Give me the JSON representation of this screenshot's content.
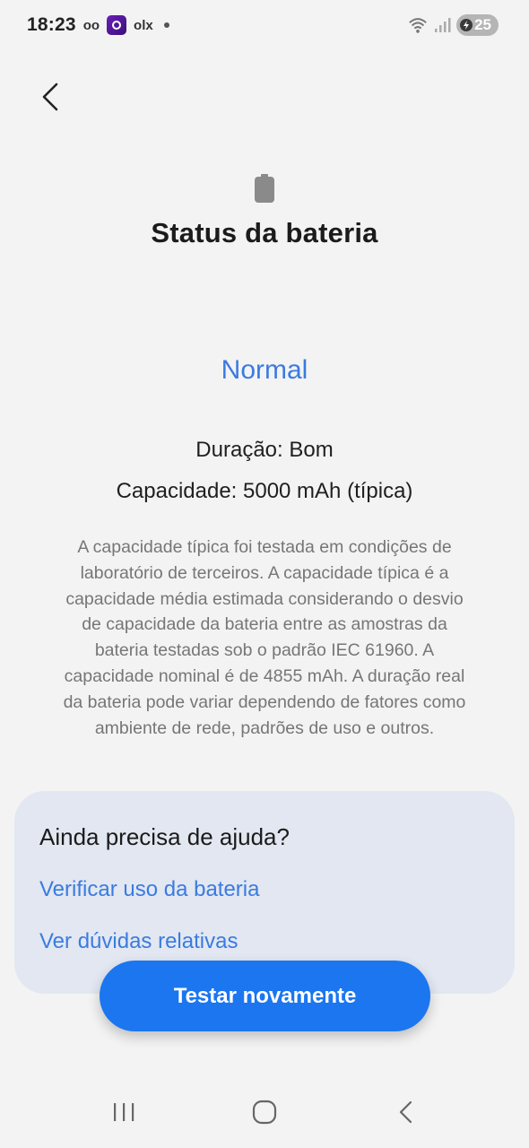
{
  "status_bar": {
    "time": "18:23",
    "voicemail_glyph": "oo",
    "app_label": "olx",
    "battery_level": "25"
  },
  "header": {
    "title": "Status da bateria"
  },
  "battery_status": {
    "value": "Normal",
    "duration": "Duração: Bom",
    "capacity": "Capacidade: 5000 mAh (típica)",
    "description": "A capacidade típica foi testada em condições de laboratório de terceiros. A capacidade típica é a capacidade média estimada considerando o desvio de capacidade da bateria entre as amostras da bateria testadas sob o padrão IEC 61960. A capacidade nominal é de 4855 mAh. A duração real da bateria pode variar dependendo de fatores como ambiente de rede, padrões de uso e outros."
  },
  "help_card": {
    "title": "Ainda precisa de ajuda?",
    "links": [
      {
        "label": "Verificar uso da bateria"
      },
      {
        "label": "Ver dúvidas relativas"
      }
    ]
  },
  "actions": {
    "retest_label": "Testar novamente"
  },
  "colors": {
    "accent": "#3a7be0",
    "button": "#1b76f0",
    "card": "#e2e7f1",
    "background": "#f3f3f3"
  },
  "icons": {
    "back": "chevron-left-icon",
    "battery": "battery-icon",
    "nav_recents": "recents-icon",
    "nav_home": "home-icon",
    "nav_back": "back-icon"
  }
}
